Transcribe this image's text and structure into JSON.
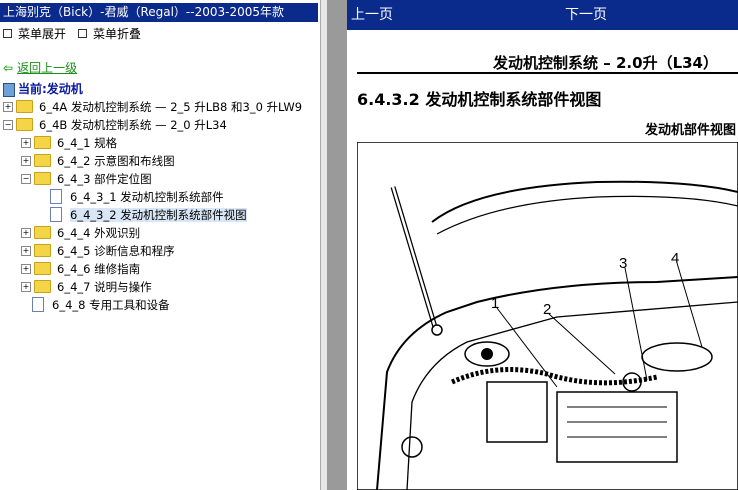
{
  "left_panel": {
    "title": "上海别克（Bick）-君威（Regal）--2003-2005年款",
    "expand_label": "菜单展开",
    "collapse_label": "菜单折叠",
    "back_label": "返回上一级",
    "current_label": "当前:发动机",
    "tree": [
      {
        "label": "6_4A 发动机控制系统 — 2_5 升LB8 和3_0 升LW9",
        "type": "folder",
        "toggle": "+"
      },
      {
        "label": "6_4B 发动机控制系统 — 2_0 升L34",
        "type": "folder",
        "toggle": "−"
      },
      {
        "label": "6_4_1 规格",
        "type": "folder",
        "toggle": "+"
      },
      {
        "label": "6_4_2 示意图和布线图",
        "type": "folder",
        "toggle": "+"
      },
      {
        "label": "6_4_3 部件定位图",
        "type": "folder",
        "toggle": "−"
      },
      {
        "label": "6_4_3_1 发动机控制系统部件",
        "type": "doc",
        "toggle": ""
      },
      {
        "label": "6_4_3_2 发动机控制系统部件视图",
        "type": "doc",
        "toggle": "",
        "selected": true
      },
      {
        "label": "6_4_4 外观识别",
        "type": "folder",
        "toggle": "+"
      },
      {
        "label": "6_4_5 诊断信息和程序",
        "type": "folder",
        "toggle": "+"
      },
      {
        "label": "6_4_6 维修指南",
        "type": "folder",
        "toggle": "+"
      },
      {
        "label": "6_4_7 说明与操作",
        "type": "folder",
        "toggle": "+"
      },
      {
        "label": "6_4_8 专用工具和设备",
        "type": "doc",
        "toggle": ""
      }
    ]
  },
  "right_panel": {
    "prev_label": "上一页",
    "next_label": "下一页",
    "doc_header": "发动机控制系统 – 2.0升（L34）",
    "section_title": "6.4.3.2  发动机控制系统部件视图",
    "view_label": "发动机部件视图",
    "callouts": [
      "1",
      "2",
      "3",
      "4"
    ]
  },
  "colors": {
    "title_bar": "#0a2a8c",
    "nav_bar": "#0a2a8c",
    "back_link": "#1a8f1a",
    "current": "#0a1a9c",
    "selected_bg": "#d8e6f6"
  }
}
